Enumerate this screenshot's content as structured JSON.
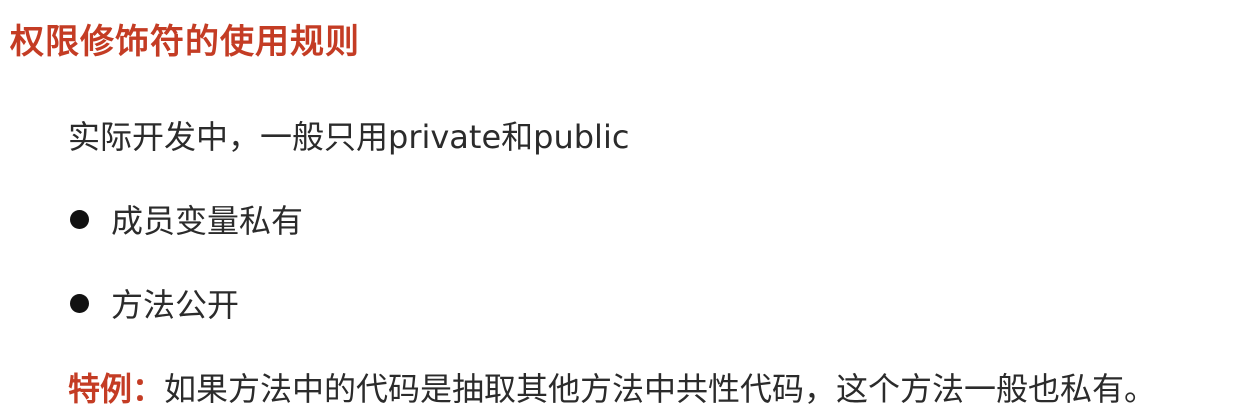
{
  "title": "权限修饰符的使用规则",
  "intro": "实际开发中，一般只用private和public",
  "bullets": [
    {
      "text": "成员变量私有"
    },
    {
      "text": "方法公开"
    }
  ],
  "note": {
    "label": "特例：",
    "text": "如果方法中的代码是抽取其他方法中共性代码，这个方法一般也私有。"
  },
  "colors": {
    "accent": "#c43c24",
    "text": "#2b2b2b",
    "bullet": "#111111"
  },
  "icons": {
    "bullet": "bullet-dot-icon"
  }
}
